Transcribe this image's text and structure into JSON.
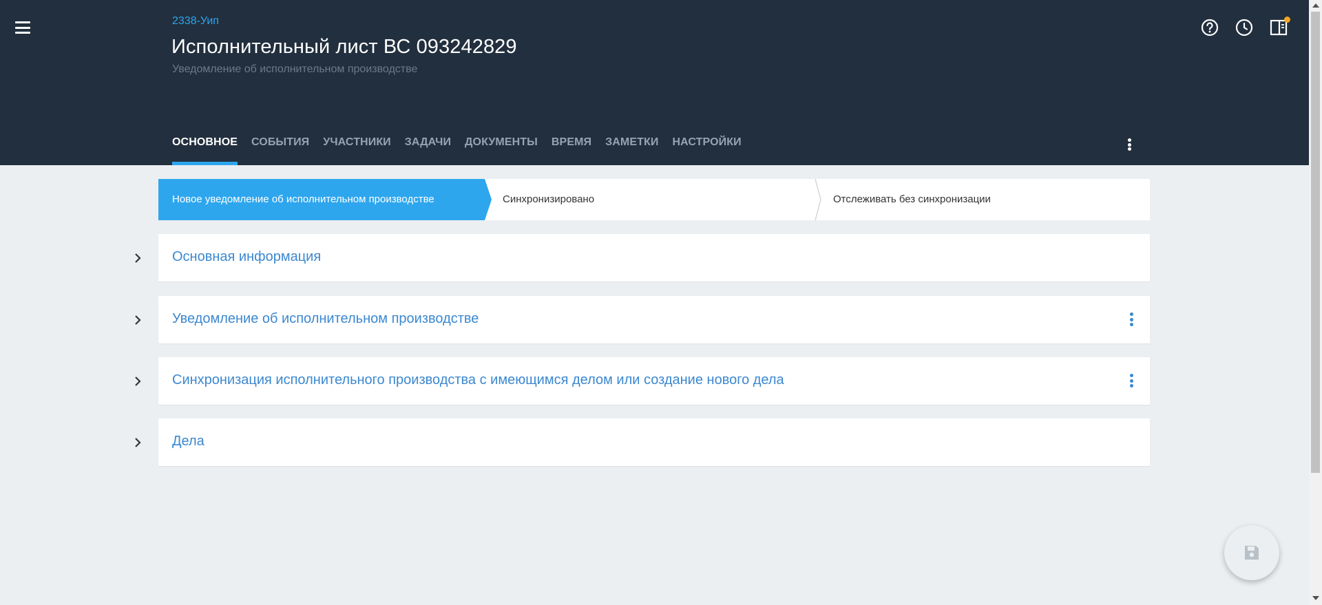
{
  "header": {
    "case_number": "2338-Уип",
    "title": "Исполнительный лист ВС 093242829",
    "subtitle": "Уведомление об исполнительном производстве"
  },
  "header_icons": [
    "help-icon",
    "history-clock-icon",
    "panel-icon"
  ],
  "tabs": [
    {
      "label": "ОСНОВНОЕ",
      "active": true
    },
    {
      "label": "СОБЫТИЯ",
      "active": false
    },
    {
      "label": "УЧАСТНИКИ",
      "active": false
    },
    {
      "label": "ЗАДАЧИ",
      "active": false
    },
    {
      "label": "ДОКУМЕНТЫ",
      "active": false
    },
    {
      "label": "ВРЕМЯ",
      "active": false
    },
    {
      "label": "ЗАМЕТКИ",
      "active": false
    },
    {
      "label": "НАСТРОЙКИ",
      "active": false
    }
  ],
  "stepper": {
    "steps": [
      {
        "label": "Новое уведомление об исполнительном производстве",
        "active": true
      },
      {
        "label": "Синхронизировано",
        "active": false
      },
      {
        "label": "Отслеживать без синхронизации",
        "active": false
      }
    ]
  },
  "sections": [
    {
      "title": "Основная информация",
      "has_menu": false
    },
    {
      "title": "Уведомление об исполнительном производстве",
      "has_menu": true
    },
    {
      "title": "Синхронизация исполнительного производства с имеющимся делом или создание нового дела",
      "has_menu": true
    },
    {
      "title": "Дела",
      "has_menu": false
    }
  ],
  "colors": {
    "header_bg": "#222f3e",
    "accent": "#2ea6ee",
    "link": "#3b88d0",
    "page_bg": "#eceff1",
    "notification": "#f5a623"
  }
}
